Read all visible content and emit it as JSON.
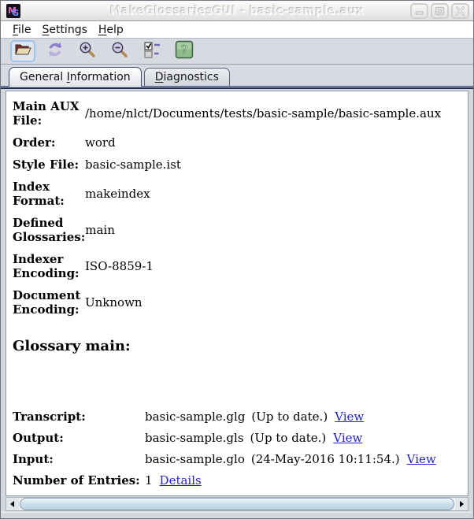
{
  "window": {
    "title": "MakeGlossariesGUI - basic-sample.aux",
    "icon_m": "M",
    "icon_g": "G"
  },
  "menubar": {
    "items": [
      {
        "pre": "",
        "key": "F",
        "post": "ile"
      },
      {
        "pre": "",
        "key": "S",
        "post": "ettings"
      },
      {
        "pre": "",
        "key": "H",
        "post": "elp"
      }
    ]
  },
  "toolbar": {
    "buttons": [
      {
        "name": "open-file"
      },
      {
        "name": "reload"
      },
      {
        "name": "zoom-in"
      },
      {
        "name": "zoom-out"
      },
      {
        "name": "properties"
      },
      {
        "name": "help"
      }
    ]
  },
  "tabs": [
    {
      "pre": "General ",
      "key": "I",
      "post": "nformation",
      "selected": true
    },
    {
      "pre": "",
      "key": "D",
      "post": "iagnostics",
      "selected": false
    }
  ],
  "general": {
    "fields": [
      {
        "label": "Main AUX File:",
        "value": "/home/nlct/Documents/tests/basic-sample/basic-sample.aux"
      },
      {
        "label": "Order:",
        "value": "word"
      },
      {
        "label": "Style File:",
        "value": "basic-sample.ist"
      },
      {
        "label": "Index Format:",
        "value": "makeindex"
      },
      {
        "label": "Defined Glossaries:",
        "value": "main"
      },
      {
        "label": "Indexer Encoding:",
        "value": "ISO-8859-1"
      },
      {
        "label": "Document Encoding:",
        "value": "Unknown"
      }
    ],
    "glossary_heading": "Glossary main:",
    "files": [
      {
        "label": "Transcript:",
        "value": "basic-sample.glg",
        "status": "(Up to date.)",
        "link": "View"
      },
      {
        "label": "Output:",
        "value": "basic-sample.gls",
        "status": "(Up to date.)",
        "link": "View"
      },
      {
        "label": "Input:",
        "value": "basic-sample.glo",
        "status": "(24-May-2016 10:11:54.)",
        "link": "View"
      },
      {
        "label": "Number of Entries:",
        "value": "1",
        "status": "",
        "link": "Details"
      }
    ]
  },
  "colors": {
    "link": "#2222cc",
    "help_green": "#8fbc8f",
    "tab_content_border": "#1f2a4d",
    "focus_ring": "#9fc4e8",
    "toolbar_bg": "#d7dae1"
  }
}
